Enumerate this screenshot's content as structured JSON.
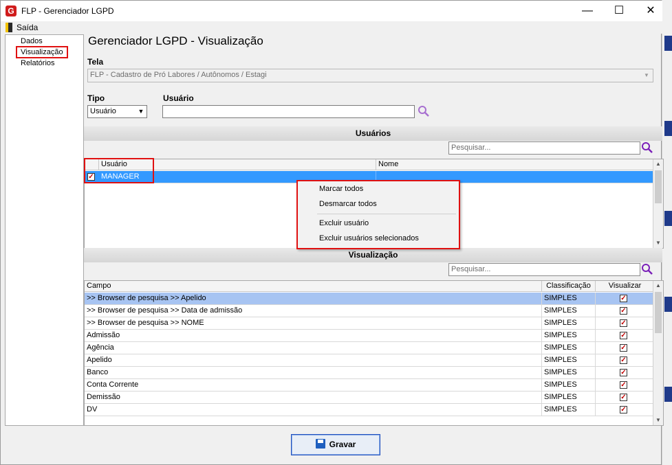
{
  "window": {
    "title": "FLP - Gerenciador LGPD",
    "controls": {
      "minimize": "—",
      "maximize": "☐",
      "close": "✕"
    }
  },
  "menu": {
    "exit_label": "Saída"
  },
  "sidebar": {
    "items": [
      {
        "label": "Dados"
      },
      {
        "label": "Visualização"
      },
      {
        "label": "Relatórios"
      }
    ]
  },
  "page": {
    "title": "Gerenciador LGPD - Visualização"
  },
  "tela": {
    "label": "Tela",
    "value": "FLP - Cadastro de Pró Labores / Autônomos / Estagi"
  },
  "tipo": {
    "label": "Tipo",
    "value": "Usuário"
  },
  "usuario_field": {
    "label": "Usuário",
    "value": ""
  },
  "users_section": {
    "header": "Usuários",
    "search_placeholder": "Pesquisar...",
    "columns": [
      "Usuário",
      "Nome"
    ],
    "rows": [
      {
        "checked": true,
        "user": "MANAGER",
        "name": ""
      }
    ]
  },
  "context_menu": {
    "items": [
      "Marcar todos",
      "Desmarcar todos",
      "Excluir usuário",
      "Excluir usuários selecionados"
    ]
  },
  "view_section": {
    "header": "Visualização",
    "search_placeholder": "Pesquisar...",
    "columns": [
      "Campo",
      "Classificação",
      "Visualizar"
    ],
    "rows": [
      {
        "campo": ">> Browser de pesquisa >> Apelido",
        "class": "SIMPLES",
        "visualizar": true
      },
      {
        "campo": ">> Browser de pesquisa >> Data de admissão",
        "class": "SIMPLES",
        "visualizar": true
      },
      {
        "campo": ">> Browser de pesquisa >> NOME",
        "class": "SIMPLES",
        "visualizar": true
      },
      {
        "campo": "Admissão",
        "class": "SIMPLES",
        "visualizar": true
      },
      {
        "campo": "Agência",
        "class": "SIMPLES",
        "visualizar": true
      },
      {
        "campo": "Apelido",
        "class": "SIMPLES",
        "visualizar": true
      },
      {
        "campo": "Banco",
        "class": "SIMPLES",
        "visualizar": true
      },
      {
        "campo": "Conta Corrente",
        "class": "SIMPLES",
        "visualizar": true
      },
      {
        "campo": "Demissão",
        "class": "SIMPLES",
        "visualizar": true
      },
      {
        "campo": "DV",
        "class": "SIMPLES",
        "visualizar": true
      }
    ]
  },
  "footer": {
    "save_label": "Gravar"
  },
  "colors": {
    "highlight": "#e01010",
    "selection": "#3399ff",
    "accent": "#1f4fbf"
  }
}
